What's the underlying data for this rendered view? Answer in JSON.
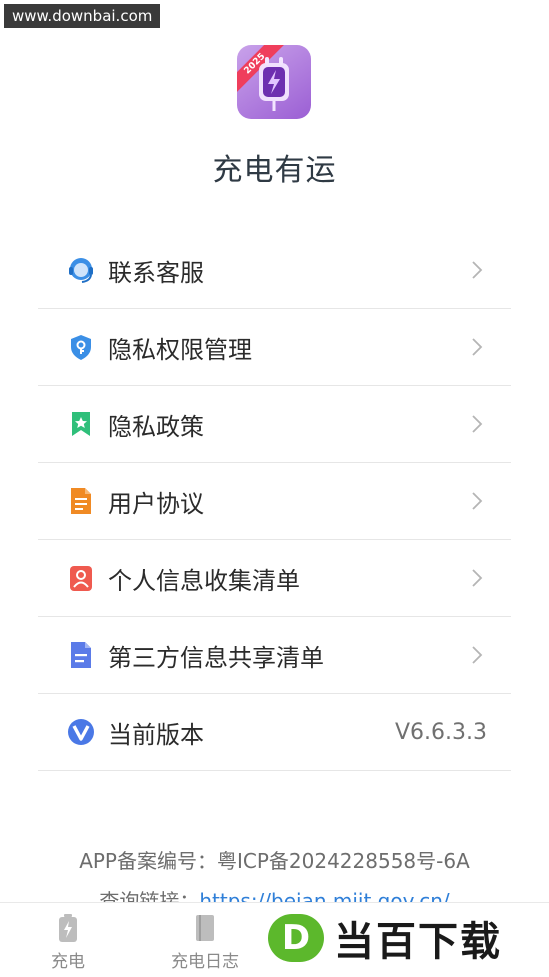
{
  "watermark": "www.downbai.com",
  "app": {
    "badge_year": "2025",
    "name": "充电有运"
  },
  "menu": [
    {
      "label": "联系客服",
      "icon": "headset-icon"
    },
    {
      "label": "隐私权限管理",
      "icon": "shield-key-icon"
    },
    {
      "label": "隐私政策",
      "icon": "bookmark-star-icon"
    },
    {
      "label": "用户协议",
      "icon": "document-icon"
    },
    {
      "label": "个人信息收集清单",
      "icon": "person-card-icon"
    },
    {
      "label": "第三方信息共享清单",
      "icon": "list-document-icon"
    },
    {
      "label": "当前版本",
      "icon": "v-logo-icon",
      "value": "V6.6.3.3"
    }
  ],
  "footer": {
    "icp": "APP备案编号：粤ICP备2024228558号-6A",
    "query_label": "查询链接：",
    "query_link": "https://beian.miit.gov.cn/"
  },
  "tabs": [
    {
      "label": "充电",
      "icon": "battery-icon"
    },
    {
      "label": "充电日志",
      "icon": "log-book-icon"
    }
  ],
  "brand_overlay": {
    "letter": "D",
    "text": "当百下载"
  },
  "colors": {
    "app_icon": "#9b5fd4",
    "headset": "#3b8fe6",
    "shield": "#3b8fe6",
    "bookmark": "#2fbf7a",
    "document": "#f08a24",
    "person": "#ef5a4f",
    "list": "#5b7be8",
    "version_logo": "#4a78e6",
    "link": "#2f7fd8",
    "brand_green": "#5cb82c"
  }
}
